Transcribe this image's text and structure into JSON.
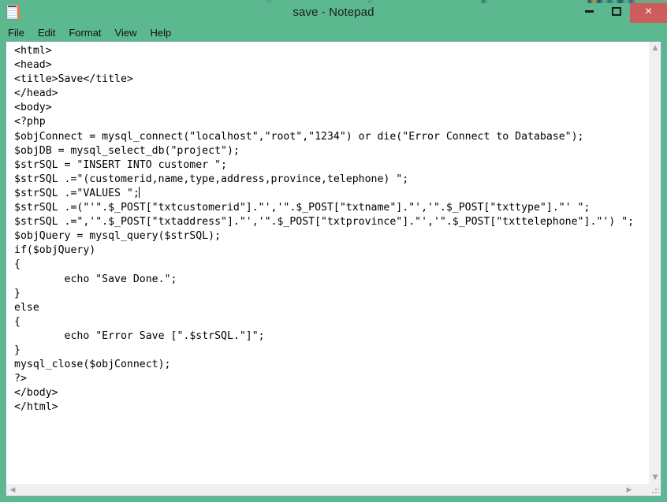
{
  "window": {
    "title": "save - Notepad",
    "app_icon": "notepad-icon",
    "titlebar_color": "#5cb98f",
    "close_button_color": "#cd5c5c",
    "controls": {
      "minimize": "–",
      "maximize": "☐",
      "close": "×"
    }
  },
  "menubar": {
    "items": [
      {
        "label": "File"
      },
      {
        "label": "Edit"
      },
      {
        "label": "Format"
      },
      {
        "label": "View"
      },
      {
        "label": "Help"
      }
    ]
  },
  "editor": {
    "content": "<html>\n<head>\n<title>Save</title>\n</head>\n<body>\n<?php\n$objConnect = mysql_connect(\"localhost\",\"root\",\"1234\") or die(\"Error Connect to Database\");\n$objDB = mysql_select_db(\"project\");\n$strSQL = \"INSERT INTO customer \";\n$strSQL .=\"(customerid,name,type,address,province,telephone) \";\n$strSQL .=\"VALUES \";",
    "content_after_caret": "\n$strSQL .=(\"'\".$_POST[\"txtcustomerid\"].\"','\".$_POST[\"txtname\"].\"','\".$_POST[\"txttype\"].\"' \";\n$strSQL .=\",'\".$_POST[\"txtaddress\"].\"','\".$_POST[\"txtprovince\"].\"','\".$_POST[\"txttelephone\"].\"') \";\n$objQuery = mysql_query($strSQL);\nif($objQuery)\n{\n\techo \"Save Done.\";\n}\nelse\n{\n\techo \"Error Save [\".$strSQL.\"]\";\n}\nmysql_close($objConnect);\n?>\n</body>\n</html>",
    "caret_visible": true,
    "background": "#ffffff",
    "text_color": "#000000"
  },
  "scrollbars": {
    "vertical": {
      "up_arrow": "▲",
      "down_arrow": "▼"
    },
    "horizontal": {
      "left_arrow": "◀",
      "right_arrow": "▶"
    },
    "resize_grip": "resize-grip-icon"
  }
}
